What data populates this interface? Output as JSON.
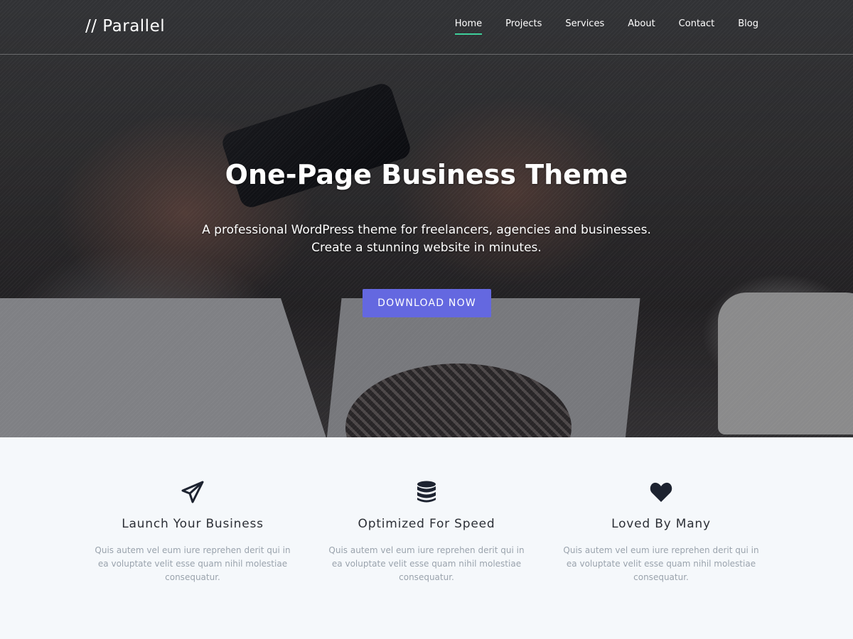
{
  "header": {
    "logo": "// Parallel",
    "nav": [
      {
        "label": "Home",
        "active": true
      },
      {
        "label": "Projects",
        "active": false
      },
      {
        "label": "Services",
        "active": false
      },
      {
        "label": "About",
        "active": false
      },
      {
        "label": "Contact",
        "active": false
      },
      {
        "label": "Blog",
        "active": false
      }
    ]
  },
  "hero": {
    "title": "One-Page Business Theme",
    "subtitle_line1": "A professional WordPress theme for freelancers, agencies and businesses.",
    "subtitle_line2": "Create a stunning website in minutes.",
    "cta_label": "DOWNLOAD NOW"
  },
  "features": [
    {
      "icon": "paper-plane-icon",
      "title": "Launch Your Business",
      "text": "Quis autem vel eum iure reprehen derit qui in ea voluptate velit esse quam nihil molestiae consequatur."
    },
    {
      "icon": "database-icon",
      "title": "Optimized For Speed",
      "text": "Quis autem vel eum iure reprehen derit qui in ea voluptate velit esse quam nihil molestiae consequatur."
    },
    {
      "icon": "heart-icon",
      "title": "Loved By Many",
      "text": "Quis autem vel eum iure reprehen derit qui in ea voluptate velit esse quam nihil molestiae consequatur."
    }
  ],
  "colors": {
    "accent": "#6468e0",
    "nav_active_underline": "#3ecf9b",
    "feature_bg": "#f5f8fb",
    "feature_title": "#2c2f36",
    "feature_text": "#9aa3ad"
  }
}
